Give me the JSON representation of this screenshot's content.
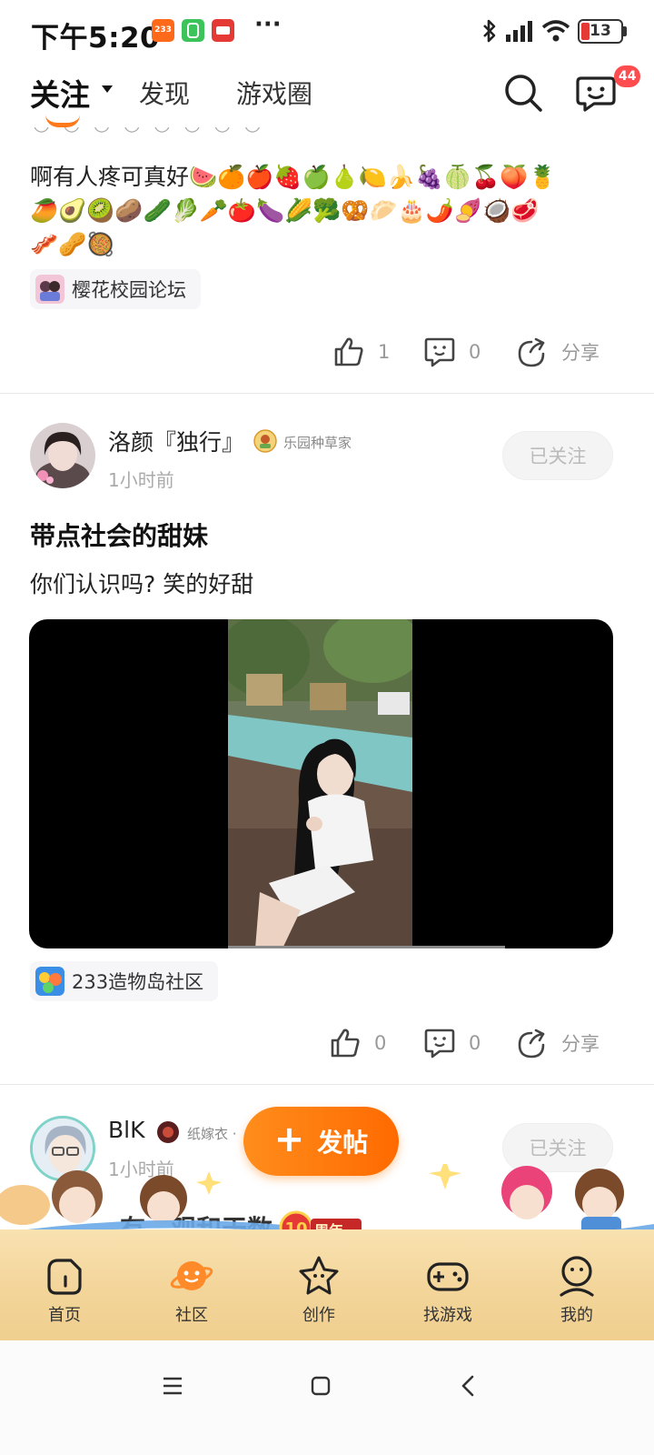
{
  "status_bar": {
    "time": "下午5:20",
    "app_icons": [
      {
        "name": "233-app-icon",
        "label": "233",
        "color": "#ff6a1a"
      },
      {
        "name": "app-green-icon",
        "label": "",
        "color": "#3cc45b"
      },
      {
        "name": "app-red-icon",
        "label": "",
        "color": "#e53935"
      }
    ],
    "more": "···",
    "battery": "13"
  },
  "header": {
    "tabs": [
      {
        "label": "关注",
        "active": true
      },
      {
        "label": "发现",
        "active": false
      },
      {
        "label": "游戏圈",
        "active": false
      }
    ],
    "message_badge": "44",
    "accent": "#ff7a1a"
  },
  "post1": {
    "text_line1": "啊有人疼可真好🍉🍊🍎🍓🍏🍐🍋🍌🍇🍈🍒🍑🍍",
    "text_line2": "🥭🥑🥝🥔🥒🥬🥕🍅🍆🌽🥦🥨🥟🎂🌶️🍠🥥🥩",
    "text_line3": "🥓🥜🥘",
    "circle": "樱花校园论坛",
    "likes": "1",
    "comments": "0",
    "share": "分享"
  },
  "post2": {
    "author": "洛颜『独行』",
    "badge": "乐园种草家",
    "time": "1小时前",
    "follow": "已关注",
    "title": "带点社会的甜妹",
    "body": "你们认识吗? 笑的好甜",
    "circle": "233造物岛社区",
    "likes": "0",
    "comments": "0",
    "share": "分享"
  },
  "post3": {
    "author": "BlK",
    "badge": "纸嫁衣 ·",
    "time": "1小时前",
    "follow": "已关注",
    "title_partial": "…有…观和天数"
  },
  "publish_button": {
    "label": "发帖"
  },
  "anniversary": {
    "label": "周年"
  },
  "bottom_nav": [
    {
      "label": "首页",
      "icon": "home-icon",
      "active": false
    },
    {
      "label": "社区",
      "icon": "planet-icon",
      "active": true
    },
    {
      "label": "创作",
      "icon": "star-icon",
      "active": false
    },
    {
      "label": "找游戏",
      "icon": "gamepad-icon",
      "active": false
    },
    {
      "label": "我的",
      "icon": "profile-icon",
      "active": false
    }
  ]
}
